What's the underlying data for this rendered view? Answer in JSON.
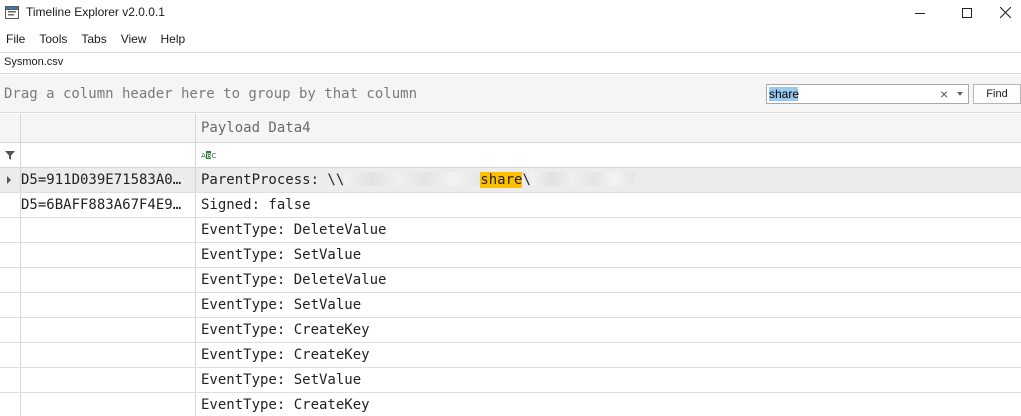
{
  "window": {
    "title": "Timeline Explorer v2.0.0.1"
  },
  "menu": [
    "File",
    "Tools",
    "Tabs",
    "View",
    "Help"
  ],
  "tabs": [
    {
      "label": "Sysmon.csv"
    }
  ],
  "group_panel": {
    "hint": "Drag a column header here to group by that column"
  },
  "search": {
    "value": "share",
    "find_label": "Find"
  },
  "grid": {
    "columns": [
      "",
      "Payload Data4"
    ],
    "rows": [
      {
        "c1": "D5=911D039E71583A0…",
        "c2_prefix": "ParentProcess: \\\\",
        "c2_match": "share",
        "c2_suffix": "\\",
        "expandable": true,
        "selected": true
      },
      {
        "c1": "D5=6BAFF883A67F4E9…",
        "c2": "Signed: false"
      },
      {
        "c1": "",
        "c2": "EventType: DeleteValue"
      },
      {
        "c1": "",
        "c2": "EventType: SetValue"
      },
      {
        "c1": "",
        "c2": "EventType: DeleteValue"
      },
      {
        "c1": "",
        "c2": "EventType: SetValue"
      },
      {
        "c1": "",
        "c2": "EventType: CreateKey"
      },
      {
        "c1": "",
        "c2": "EventType: CreateKey"
      },
      {
        "c1": "",
        "c2": "EventType: SetValue"
      },
      {
        "c1": "",
        "c2": "EventType: CreateKey"
      }
    ]
  },
  "colors": {
    "highlight": "#ffc000",
    "selected_row": "#ececec",
    "search_selection": "#99c9ef"
  },
  "icons": [
    "app-icon",
    "minimize-icon",
    "maximize-icon",
    "close-icon",
    "clear-icon",
    "dropdown-icon",
    "filter-icon",
    "text-filter-icon",
    "expand-icon"
  ]
}
